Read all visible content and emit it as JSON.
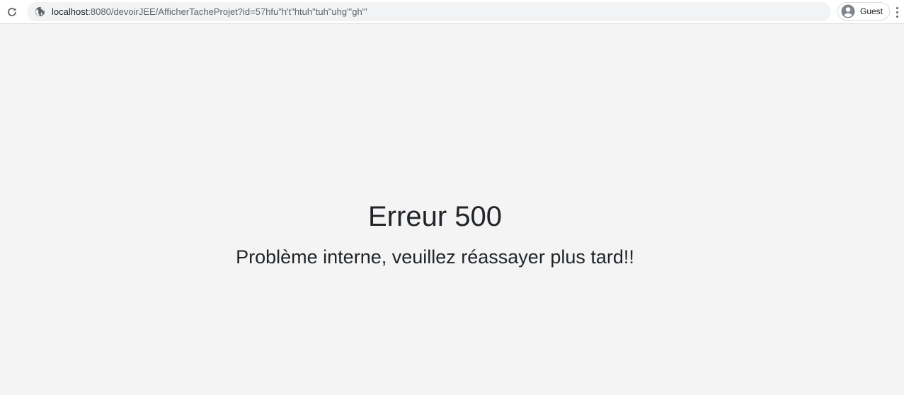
{
  "browser": {
    "url_host": "localhost",
    "url_rest": ":8080/devoirJEE/AfficherTacheProjet?id=57hfu\"h't\"htuh\"tuh\"uhg\"'gh\"'",
    "profile_label": "Guest",
    "icons": {
      "reload": "reload-icon",
      "site_info": "globe-icon",
      "profile": "account-circle-icon",
      "menu": "more-vertical-icon"
    }
  },
  "page": {
    "title": "Erreur 500",
    "message": "Problème interne, veuillez réassayer plus tard!!"
  },
  "colors": {
    "page_background": "#f4f4f4",
    "text": "#212529",
    "toolbar_background": "#ffffff",
    "omnibox_background": "#f1f3f4"
  }
}
